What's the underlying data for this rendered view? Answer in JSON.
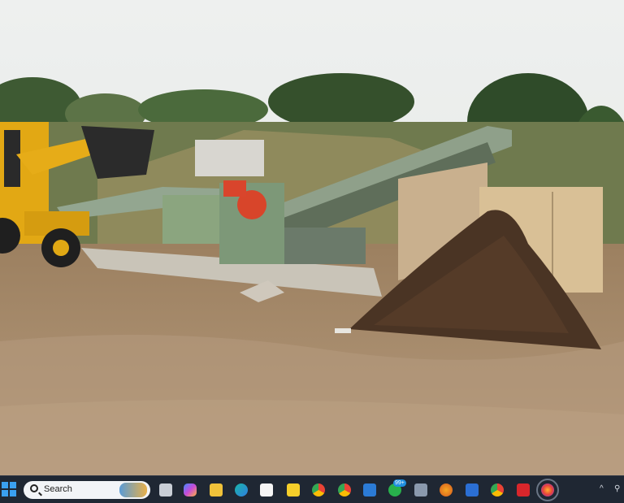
{
  "taskbar": {
    "search_label": "Search",
    "whatsapp_badge": "99+",
    "chrome_badge": "",
    "icons": [
      "windows-start-icon",
      "search-icon",
      "task-view-icon",
      "copilot-icon",
      "file-explorer-icon",
      "edge-icon",
      "store-icon",
      "sticky-notes-icon",
      "chrome-icon",
      "chrome-profile-icon",
      "photos-icon",
      "whatsapp-icon",
      "calculator-icon",
      "paint-icon",
      "word-icon",
      "chrome-alt-icon",
      "acrobat-icon",
      "firefox-icon"
    ],
    "tray": {
      "chevron": "^"
    }
  },
  "colors": {
    "taskbar_bg": "#1f2733",
    "accent": "#3aa0f0"
  }
}
